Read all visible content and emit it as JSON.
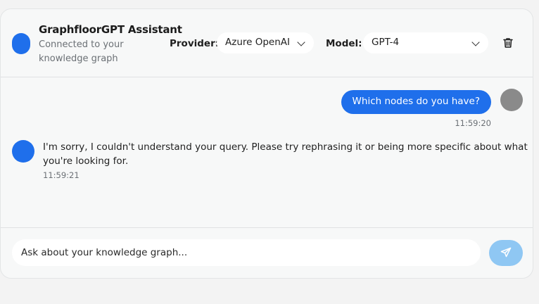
{
  "header": {
    "title": "GraphfloorGPT Assistant",
    "subtitle": "Connected to your knowledge graph",
    "provider_label": "Provider:",
    "provider_value": "Azure OpenAI",
    "model_label": "Model:",
    "model_value": "GPT-4"
  },
  "messages": {
    "user_text": "Which nodes do you have?",
    "user_time": "11:59:20",
    "bot_text": "I'm sorry, I couldn't understand your query. Please try rephrasing it or being more specific about what you're looking for.",
    "bot_time": "11:59:21"
  },
  "composer": {
    "placeholder": "Ask about your knowledge graph..."
  },
  "colors": {
    "accent": "#1f6feb",
    "send_disabled": "#8fc7f3",
    "user_avatar": "#8a8a8a"
  },
  "icons": [
    "trash-icon",
    "chevron-down-icon",
    "send-icon"
  ]
}
